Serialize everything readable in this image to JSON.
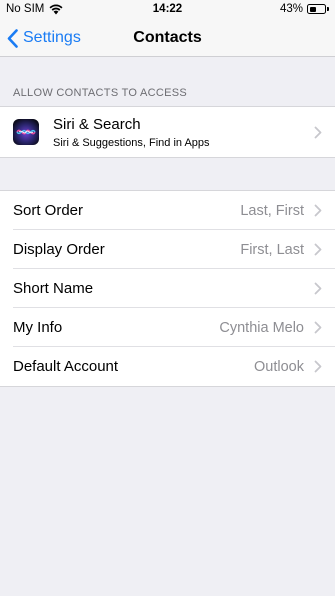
{
  "status_bar": {
    "carrier": "No SIM",
    "time": "14:22",
    "battery_percent": "43%",
    "battery_level": 0.43
  },
  "nav": {
    "back_label": "Settings",
    "title": "Contacts"
  },
  "section_header": "ALLOW CONTACTS TO ACCESS",
  "siri": {
    "title": "Siri & Search",
    "subtitle": "Siri & Suggestions, Find in Apps",
    "icon": "siri-icon"
  },
  "rows": [
    {
      "label": "Sort Order",
      "value": "Last, First"
    },
    {
      "label": "Display Order",
      "value": "First, Last"
    },
    {
      "label": "Short Name",
      "value": ""
    },
    {
      "label": "My Info",
      "value": "Cynthia Melo"
    },
    {
      "label": "Default Account",
      "value": "Outlook"
    }
  ],
  "colors": {
    "accent": "#1a7cf4",
    "background": "#efeff4",
    "secondary_text": "#8e8e93"
  }
}
